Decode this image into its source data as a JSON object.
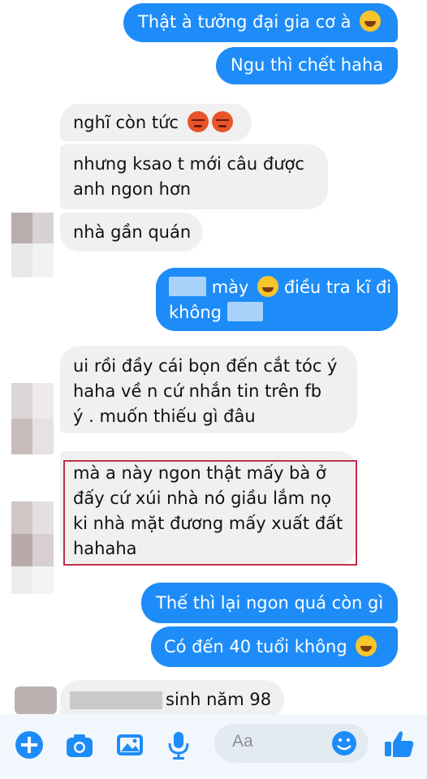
{
  "messages": [
    {
      "id": "m1",
      "text": "Thật à tưởng đại gia cơ à"
    },
    {
      "id": "m2",
      "text": "Ngu thì chết haha"
    },
    {
      "id": "m3",
      "text": "nghĩ còn tức"
    },
    {
      "id": "m4_l1",
      "text": "nhưng ksao t mới câu được"
    },
    {
      "id": "m4_l2",
      "text": "anh ngon hơn"
    },
    {
      "id": "m5",
      "text": "nhà gần quán"
    },
    {
      "id": "m6_l1",
      "text": "mày"
    },
    {
      "id": "m6_l1b",
      "text": "điều tra kĩ đi"
    },
    {
      "id": "m6_l2",
      "text": "không"
    },
    {
      "id": "m7_l1",
      "text": "ui rồi đầy cái bọn đến cắt tóc ý"
    },
    {
      "id": "m7_l2",
      "text": "haha về n cứ nhắn tin trên fb"
    },
    {
      "id": "m7_l3",
      "text": "ý . muốn thiếu gì đâu"
    },
    {
      "id": "m8_l1",
      "text": "mà a này ngon thật mấy bà ở"
    },
    {
      "id": "m8_l2",
      "text": "đấy cứ xúi nhà nó giầu lắm nọ"
    },
    {
      "id": "m8_l3",
      "text": "ki nhà mặt đương mấy xuất đất"
    },
    {
      "id": "m8_l4",
      "text": "hahaha"
    },
    {
      "id": "m9",
      "text": "Thế thì lại ngon quá còn gì"
    },
    {
      "id": "m10",
      "text": "Có đến 40 tuổi không"
    },
    {
      "id": "m11",
      "text": "sinh năm 98"
    }
  ],
  "composer": {
    "placeholder": "Aa"
  },
  "icons": [
    "plus-icon",
    "camera-icon",
    "image-icon",
    "microphone-icon",
    "emoji-icon",
    "thumbs-up-icon"
  ],
  "colors": {
    "outgoing": "#1e8cf8",
    "incoming": "#f0f0f0",
    "highlight": "#c0304a",
    "toolbar_icon": "#1e8cf8"
  }
}
